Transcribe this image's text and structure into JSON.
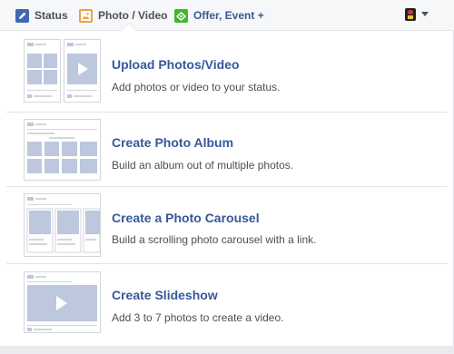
{
  "tabs": [
    {
      "label": "Status",
      "icon": "pencil-icon"
    },
    {
      "label": "Photo / Video",
      "icon": "photo-icon",
      "active": true
    },
    {
      "label": "Offer, Event +",
      "icon": "offer-icon"
    }
  ],
  "options": [
    {
      "title": "Upload Photos/Video",
      "description": "Add photos or video to your status."
    },
    {
      "title": "Create Photo Album",
      "description": "Build an album out of multiple photos."
    },
    {
      "title": "Create a Photo Carousel",
      "description": "Build a scrolling photo carousel with a link."
    },
    {
      "title": "Create Slideshow",
      "description": "Add 3 to 7 photos to create a video."
    }
  ],
  "colors": {
    "link": "#365899",
    "thumb_fill": "#bdc7dd",
    "tab_bg": "#f6f7f9",
    "page_bg": "#e9ebee"
  }
}
